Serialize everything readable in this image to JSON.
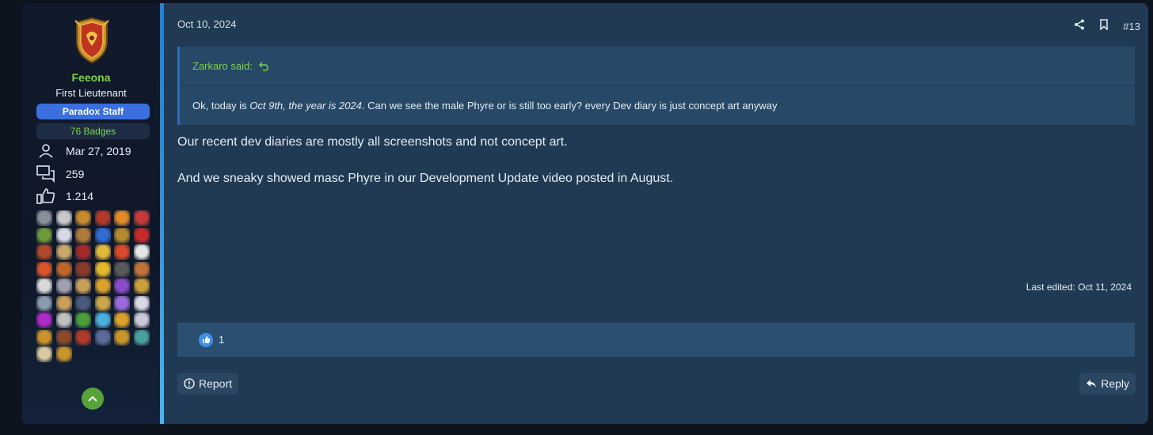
{
  "user": {
    "name": "Feeona",
    "title": "First Lieutenant",
    "staff_badge": "Paradox Staff",
    "badges_label": "76 Badges",
    "joined": "Mar 27, 2019",
    "messages": "259",
    "reactions": "1.214",
    "avatar_icon": "crest-shield-icon",
    "name_color": "#7bd34a"
  },
  "post": {
    "date": "Oct 10, 2024",
    "number": "#13",
    "quote_author": "Zarkaro said:",
    "quote_text_1": "Ok, today is ",
    "quote_text_2": "Oct 9th, the year is 2024",
    "quote_text_3": ". Can we see the male Phyre or is still too early? every Dev diary is just concept art anyway",
    "message_1": "Our recent dev diaries are mostly all screenshots and not concept art.",
    "message_2": "And we sneaky showed masc Phyre in our Development Update video posted in August.",
    "last_edited": "Last edited: Oct 11, 2024",
    "like_count": "1",
    "report_label": "Report",
    "reply_label": "Reply"
  },
  "trophy_icons": [
    "skull-icon",
    "flag-stripes-icon",
    "potion-icon",
    "dragon-icon",
    "comet-icon",
    "union-jack-icon",
    "helmet-icon",
    "mech-icon",
    "serpent-icon",
    "blue-badge-icon",
    "mask-icon",
    "red-emblem-icon",
    "tower-icon",
    "star-icon",
    "red-dragon-icon",
    "crown-icon",
    "flower-icon",
    "m-logo-icon",
    "orange-arc-icon",
    "tiger-icon",
    "flame-icon",
    "radiation-icon",
    "dark-helmet-icon",
    "rack-icon",
    "wing-icon",
    "figure-icon",
    "card-icon",
    "castle-icon",
    "purple-eye-icon",
    "compass-icon",
    "wizard-icon",
    "mage-icon",
    "book-icon",
    "gold-coin-icon",
    "crystal-icon",
    "arrow-icon",
    "purple-square-icon",
    "spqr-icon",
    "green-leaf-icon",
    "blue-gem-icon",
    "gold-shield-icon",
    "glyph-icon",
    "temple-icon",
    "crow-icon",
    "spider-icon",
    "banner-icon",
    "crossed-swords-icon",
    "planet-icon",
    "cat-icon",
    "chest-icon"
  ],
  "colors": {
    "accent": "#2d6cbd",
    "staff_badge_bg": "#3b6fe0",
    "scroll_top_bg": "#57a33a"
  }
}
